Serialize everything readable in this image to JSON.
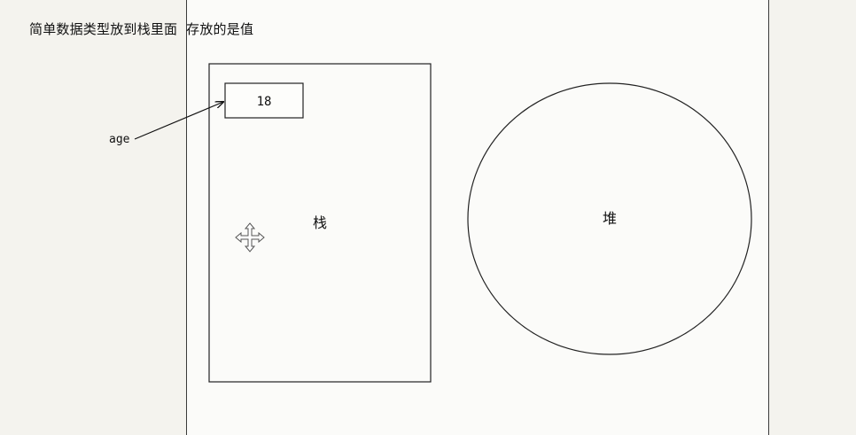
{
  "heading": "简单数据类型放到栈里面  存放的是值",
  "stack": {
    "label": "栈",
    "cell_value": "18"
  },
  "heap": {
    "label": "堆"
  },
  "pointer": {
    "variable_name": "age"
  },
  "cursor": {
    "icon": "move-cursor-icon"
  }
}
